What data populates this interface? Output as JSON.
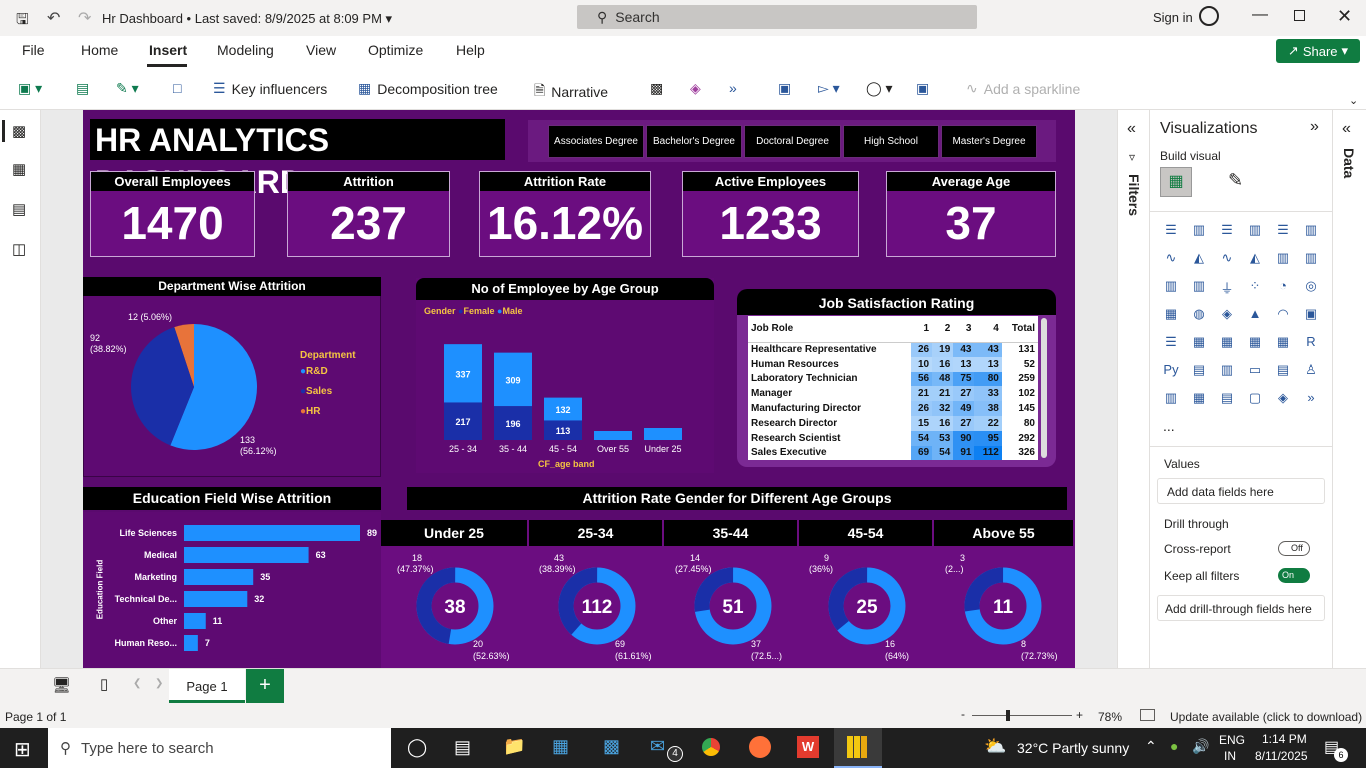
{
  "titlebar": {
    "title": "Hr Dashboard",
    "saved": "Last saved: 8/9/2025 at 8:09 PM",
    "search": "Search",
    "signin": "Sign in"
  },
  "menu": [
    "File",
    "Home",
    "Insert",
    "Modeling",
    "View",
    "Optimize",
    "Help"
  ],
  "share": "Share",
  "ribbon": {
    "key_influencers": "Key influencers",
    "decomp": "Decomposition tree",
    "narrative": "Narrative",
    "sparkline": "Add a sparkline"
  },
  "report": {
    "title": "HR ANALYTICS DASHBOARD",
    "slicers": [
      "Associates Degree",
      "Bachelor's Degree",
      "Doctoral Degree",
      "High School",
      "Master's Degree"
    ],
    "kpis": [
      {
        "label": "Overall Employees",
        "value": "1470"
      },
      {
        "label": "Attrition",
        "value": "237"
      },
      {
        "label": "Attrition Rate",
        "value": "16.12%"
      },
      {
        "label": "Active Employees",
        "value": "1233"
      },
      {
        "label": "Average Age",
        "value": "37"
      }
    ],
    "dept_title": "Department Wise Attrition",
    "dept_legend_title": "Department",
    "age_title": "No of Employee by Age Group",
    "age_legend": {
      "title": "Gender",
      "female": "Female",
      "male": "Male"
    },
    "age_xlabel": "CF_age band",
    "job_title": "Job Satisfaction Rating",
    "edu_title": "Education Field Wise Attrition",
    "edu_ylabel": "Education Field",
    "gender_title": "Attrition Rate Gender for Different Age Groups"
  },
  "chart_data": [
    {
      "type": "pie",
      "title": "Department Wise Attrition",
      "categories": [
        "R&D",
        "Sales",
        "HR"
      ],
      "values": [
        133,
        92,
        12
      ],
      "labels": [
        "133\n(56.12%)",
        "92\n(38.82%)",
        "12 (5.06%)"
      ],
      "colors": [
        "#1e90ff",
        "#1a2fa8",
        "#e8733a"
      ]
    },
    {
      "type": "bar",
      "title": "No of Employee by Age Group",
      "stacked": true,
      "categories": [
        "25 - 34",
        "35 - 44",
        "45 - 54",
        "Over 55",
        "Under 25"
      ],
      "series": [
        {
          "name": "Male",
          "values": [
            337,
            309,
            132,
            null,
            null
          ],
          "color": "#1e90ff"
        },
        {
          "name": "Female",
          "values": [
            217,
            196,
            113,
            null,
            null
          ],
          "color": "#1a2fa8"
        }
      ],
      "xlabel": "CF_age band"
    },
    {
      "type": "table",
      "title": "Job Satisfaction Rating",
      "columns": [
        "Job Role",
        "1",
        "2",
        "3",
        "4",
        "Total"
      ],
      "rows": [
        [
          "Healthcare Representative",
          "26",
          "19",
          "43",
          "43",
          "131"
        ],
        [
          "Human Resources",
          "10",
          "16",
          "13",
          "13",
          "52"
        ],
        [
          "Laboratory Technician",
          "56",
          "48",
          "75",
          "80",
          "259"
        ],
        [
          "Manager",
          "21",
          "21",
          "27",
          "33",
          "102"
        ],
        [
          "Manufacturing Director",
          "26",
          "32",
          "49",
          "38",
          "145"
        ],
        [
          "Research Director",
          "15",
          "16",
          "27",
          "22",
          "80"
        ],
        [
          "Research Scientist",
          "54",
          "53",
          "90",
          "95",
          "292"
        ],
        [
          "Sales Executive",
          "69",
          "54",
          "91",
          "112",
          "326"
        ]
      ]
    },
    {
      "type": "bar",
      "title": "Education Field Wise Attrition",
      "orientation": "horizontal",
      "categories": [
        "Life Sciences",
        "Medical",
        "Marketing",
        "Technical De...",
        "Other",
        "Human Reso..."
      ],
      "values": [
        89,
        63,
        35,
        32,
        11,
        7
      ],
      "ylabel": "Education Field"
    },
    {
      "type": "pie",
      "title": "Attrition Rate Gender for Different Age Groups",
      "donut": true,
      "groups": [
        {
          "name": "Under 25",
          "center": "38",
          "a": "18",
          "ap": "(47.37%)",
          "b": "20",
          "bp": "(52.63%)",
          "frac": 0.4737
        },
        {
          "name": "25-34",
          "center": "112",
          "a": "43",
          "ap": "(38.39%)",
          "b": "69",
          "bp": "(61.61%)",
          "frac": 0.3839
        },
        {
          "name": "35-44",
          "center": "51",
          "a": "14",
          "ap": "(27.45%)",
          "b": "37",
          "bp": "(72.5...)",
          "frac": 0.2745
        },
        {
          "name": "45-54",
          "center": "25",
          "a": "9",
          "ap": "(36%)",
          "b": "16",
          "bp": "(64%)",
          "frac": 0.36
        },
        {
          "name": "Above 55",
          "center": "11",
          "a": "3",
          "ap": "(2...)",
          "b": "8",
          "bp": "(72.73%)",
          "frac": 0.2727
        }
      ]
    }
  ],
  "filters": "Filters",
  "viz": {
    "title": "Visualizations",
    "build": "Build visual",
    "values": "Values",
    "add_fields": "Add data fields here",
    "drill": "Drill through",
    "cross": "Cross-report",
    "cross_state": "Off",
    "keep": "Keep all filters",
    "keep_state": "On",
    "drill_fields": "Add drill-through fields here",
    "more": "..."
  },
  "data_tab": "Data",
  "page": {
    "tab": "Page 1",
    "status": "Page 1 of 1",
    "zoom": "78%",
    "update": "Update available (click to download)"
  },
  "taskbar": {
    "search": "Type here to search",
    "weather": "32°C  Partly sunny",
    "lang1": "ENG",
    "lang2": "IN",
    "time": "1:14 PM",
    "date": "8/11/2025",
    "mail_badge": "4",
    "notif": "6"
  }
}
